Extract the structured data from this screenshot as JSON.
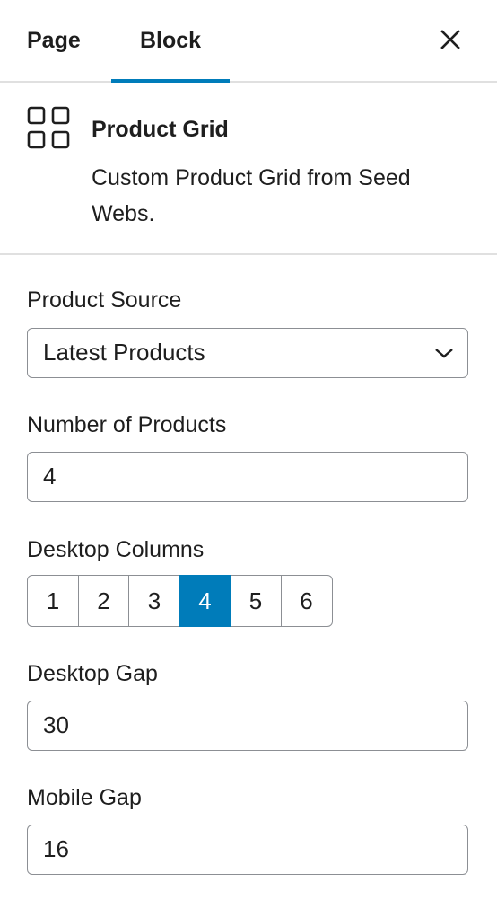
{
  "tabs": {
    "page_label": "Page",
    "block_label": "Block",
    "active": "Block"
  },
  "block": {
    "icon": "grid-icon",
    "title": "Product Grid",
    "description": "Custom Product Grid from Seed Webs."
  },
  "fields": {
    "product_source": {
      "label": "Product Source",
      "value": "Latest Products"
    },
    "number_of_products": {
      "label": "Number of Products",
      "value": "4"
    },
    "desktop_columns": {
      "label": "Desktop Columns",
      "options": [
        "1",
        "2",
        "3",
        "4",
        "5",
        "6"
      ],
      "selected": "4"
    },
    "desktop_gap": {
      "label": "Desktop Gap",
      "value": "30"
    },
    "mobile_gap": {
      "label": "Mobile Gap",
      "value": "16"
    }
  },
  "colors": {
    "accent": "#007cba",
    "border": "#8c8f94",
    "divider": "#e0e0e0"
  }
}
